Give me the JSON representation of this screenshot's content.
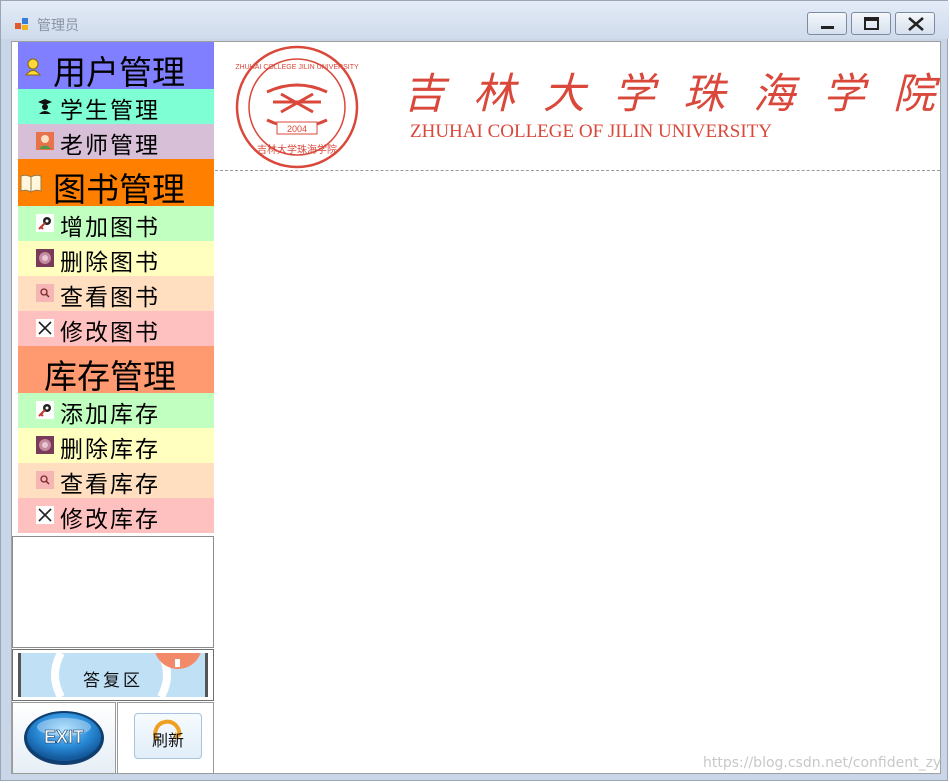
{
  "window": {
    "title": "管理员"
  },
  "sidebar": {
    "groups": [
      {
        "title": "用户管理",
        "color": "#7f7fff",
        "items": [
          {
            "label": "学生管理",
            "icon": "student-icon",
            "color": "#7fffd4"
          },
          {
            "label": "老师管理",
            "icon": "teacher-icon",
            "color": "#d8bfd8"
          }
        ]
      },
      {
        "title": "图书管理",
        "color": "#ff8000",
        "items": [
          {
            "label": "增加图书",
            "icon": "key-icon",
            "color": "#c0ffc0"
          },
          {
            "label": "删除图书",
            "icon": "delete-icon",
            "color": "#ffffc0"
          },
          {
            "label": "查看图书",
            "icon": "view-icon",
            "color": "#ffdfc0"
          },
          {
            "label": "修改图书",
            "icon": "edit-icon",
            "color": "#ffc0c0"
          }
        ]
      },
      {
        "title": "库存管理",
        "color": "#ff9970",
        "items": [
          {
            "label": "添加库存",
            "icon": "key-icon",
            "color": "#c0ffc0"
          },
          {
            "label": "删除库存",
            "icon": "delete-icon",
            "color": "#ffffc0"
          },
          {
            "label": "查看库存",
            "icon": "view-icon",
            "color": "#ffdfc0"
          },
          {
            "label": "修改库存",
            "icon": "edit-icon",
            "color": "#ffc0c0"
          }
        ]
      }
    ]
  },
  "bottom": {
    "reply_label": "答复区",
    "exit_label": "EXIT",
    "refresh_label": "刷新"
  },
  "banner": {
    "school_cn": "吉林大学珠海学院",
    "school_en": "ZHUHAI COLLEGE OF JILIN UNIVERSITY",
    "seal_top": "ZHUHAI COLLEGE JILIN UNIVERSITY",
    "seal_year": "2004",
    "seal_bottom": "吉林大学珠海学院",
    "brand_color": "#d9483b"
  },
  "watermark": "https://blog.csdn.net/confident_zy"
}
